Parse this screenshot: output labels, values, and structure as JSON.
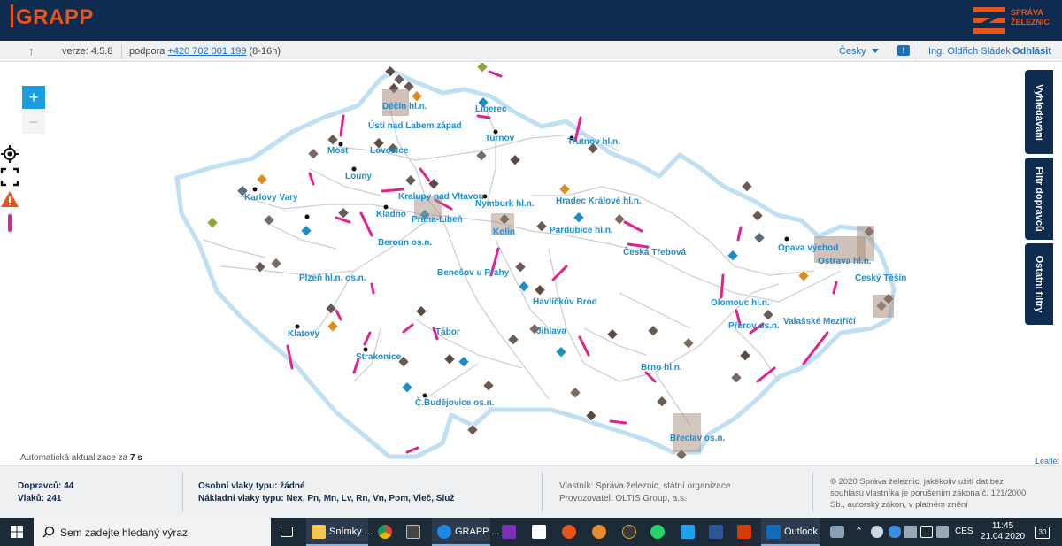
{
  "app": {
    "logo": "GRAPP",
    "brand_line1": "SPRÁVA",
    "brand_line2": "ŽELEZNIC"
  },
  "subbar": {
    "version": "verze: 4.5.8",
    "support_label": "podpora",
    "support_phone": "+420 702 001 199",
    "support_hours": "(8-16h)",
    "language": "Česky",
    "user": "Ing. Oldřich Sládek",
    "logout": "Odhlásit"
  },
  "side_tabs": [
    "Vyhledávání",
    "Filtr dopravců",
    "Ostatní filtry"
  ],
  "map": {
    "auto_update_label": "Automatická aktualizace za",
    "auto_update_value": "7 s",
    "attribution": "Leaflet",
    "cities": [
      {
        "name": "Děčín hl.n."
      },
      {
        "name": "Liberec"
      },
      {
        "name": "Ústí nad Labem západ"
      },
      {
        "name": "Turnov"
      },
      {
        "name": "Trutnov hl.n."
      },
      {
        "name": "Most"
      },
      {
        "name": "Lovosice"
      },
      {
        "name": "Louny"
      },
      {
        "name": "Karlovy Vary"
      },
      {
        "name": "Kralupy nad Vltavou"
      },
      {
        "name": "Nymburk hl.n."
      },
      {
        "name": "Hradec Králové hl.n."
      },
      {
        "name": "Kladno"
      },
      {
        "name": "Praha-Libeň"
      },
      {
        "name": "Kolín"
      },
      {
        "name": "Pardubice hl.n."
      },
      {
        "name": "Beroun os.n."
      },
      {
        "name": "Česká Třebová"
      },
      {
        "name": "Opava východ"
      },
      {
        "name": "Ostrava hl.n."
      },
      {
        "name": "Benešov u Prahy"
      },
      {
        "name": "Český Těšín"
      },
      {
        "name": "Plzeň hl.n. os.n."
      },
      {
        "name": "Havlíčkův Brod"
      },
      {
        "name": "Olomouc hl.n."
      },
      {
        "name": "Valašské Meziříčí"
      },
      {
        "name": "Klatovy"
      },
      {
        "name": "Tábor"
      },
      {
        "name": "Jihlava"
      },
      {
        "name": "Přerov os.n."
      },
      {
        "name": "Strakonice"
      },
      {
        "name": "Brno hl.n."
      },
      {
        "name": "Č.Budějovice os.n."
      },
      {
        "name": "Břeclav os.n."
      }
    ]
  },
  "footer": {
    "carriers": "Dopravců: 44",
    "trains": "Vlaků: 241",
    "passenger_types": "Osobní vlaky typu: žádné",
    "freight_types": "Nákladní vlaky typu: Nex, Pn, Mn, Lv, Rn, Vn, Pom, Vleč, Služ",
    "owner": "Vlastník: Správa železnic, státní organizace",
    "operator": "Provozovatel: OLTIS Group, a.s.",
    "copyright_1": "© 2020 Správa železnic, jakékoliv užití dat bez",
    "copyright_2": "souhlasu vlastníka je porušením zákona č. 121/2000",
    "copyright_3": "Sb., autorský zákon, v platném znění"
  },
  "taskbar": {
    "search_placeholder": "Sem zadejte hledaný výraz",
    "apps": [
      {
        "label": "Snímky ...",
        "color": "#f2c94c"
      },
      {
        "label": "GRAPP ...",
        "color": "#1e88e5"
      },
      {
        "label": "Outlook",
        "color": "#0f6cbd"
      }
    ],
    "language": "CES",
    "time": "11:45",
    "date": "21.04.2020",
    "notifications": "30"
  }
}
